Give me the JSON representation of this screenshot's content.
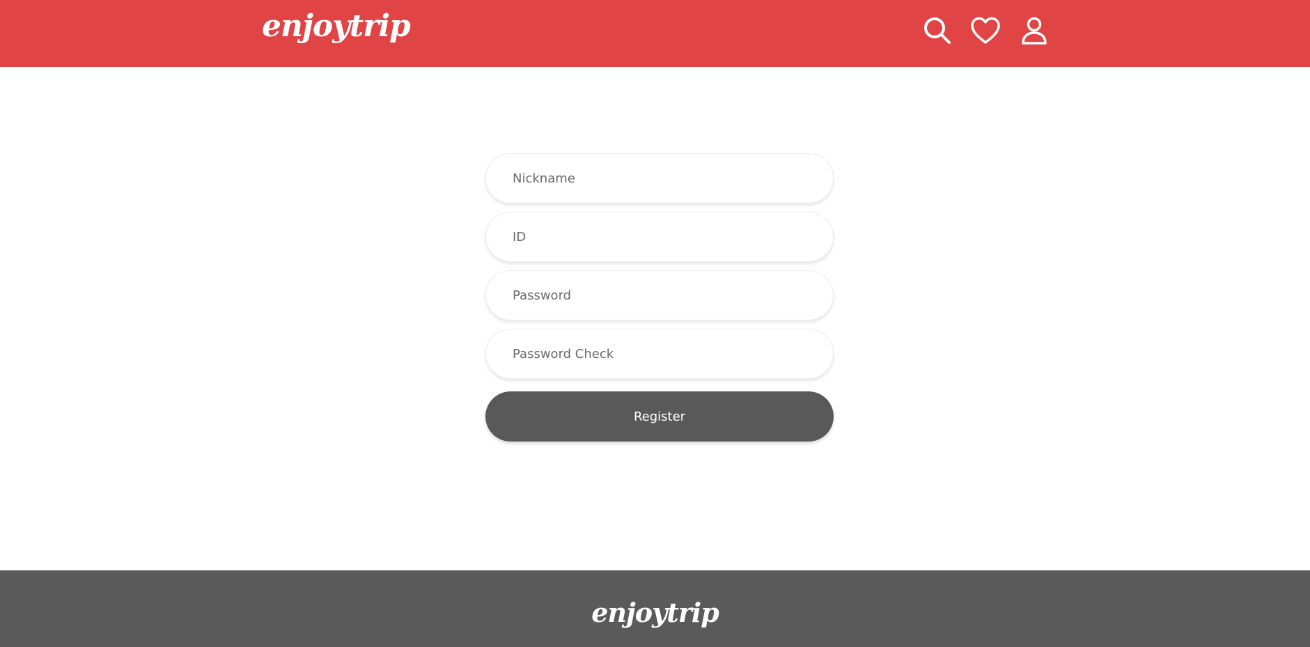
{
  "brand": {
    "logo_text": "enjoytrip",
    "primary_color": "#e04444",
    "dark_color": "#595959"
  },
  "header": {
    "icons": [
      "search-icon",
      "heart-icon",
      "user-icon"
    ]
  },
  "form": {
    "nickname_placeholder": "Nickname",
    "id_placeholder": "ID",
    "password_placeholder": "Password",
    "password_check_placeholder": "Password Check",
    "register_label": "Register"
  },
  "footer": {
    "logo_text": "enjoytrip"
  }
}
